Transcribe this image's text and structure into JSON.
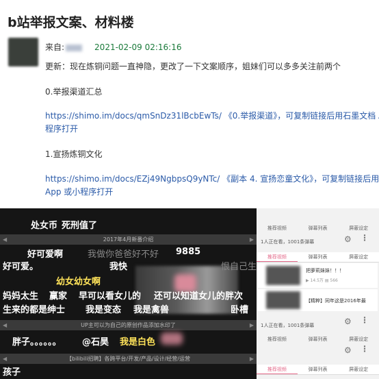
{
  "post": {
    "title": "b站举报文案、材料楼",
    "from_label": "来自:",
    "date": "2021-02-09 02:16:16",
    "update": "更新：现在炼铜问题一直神隐，更改了一下文案顺序，姐妹们可以多多关注前两个",
    "section0_title": "0.举报渠道汇总",
    "section0_url": "https://shimo.im/docs/qmSnDz31lBcbEwTs/",
    "section0_doc": "《0.举报渠道》",
    "section0_suffix": "，可复制链接后用石墨文档 App 或小",
    "section0_suffix2": "程序打开",
    "section1_title": "1.宣扬炼铜文化",
    "section1_url": "https://shimo.im/docs/EZj49NgbpsQ9yNTc/",
    "section1_doc": "《副本 4. 宣扬恋童文化》",
    "section1_suffix": "，可复制链接后用石墨文档",
    "section1_suffix2": "App 或小程序打开"
  },
  "video": {
    "bar1": "2017年4月新番介绍",
    "bar2": "UP主可以为自己的原创作品添加水印了",
    "bar3": "【bilibili招聘】各跨平台/开发/产品/设计/经营/运营",
    "danmaku": [
      "处女币",
      "死刑值了",
      "好可爱啊",
      "我做你爸爸好不好",
      "9885",
      "好可爱。",
      "我快",
      "恨自己生",
      "幼女幼女啊",
      "妈妈太生",
      "赢家",
      "早可以看女儿的",
      "还可以知道女儿的胖次",
      "生来的都是绅士",
      "我是变态",
      "我是禽兽",
      "卧槽",
      "胖子。。。。。。",
      "@石昊",
      "我是白色",
      "孩子"
    ]
  },
  "side": {
    "watching1": "1人正在看，1001条弹幕",
    "watching2": "1人正在看，1001条弹幕",
    "tab_recommend": "推荐视频",
    "tab_danmaku": "弹幕列表",
    "tab_settings": "屏蔽设定",
    "card1_title": "把萝莉妹妹！！！",
    "card1_plays": "14.5万",
    "card1_danmaku": "566",
    "card2_title": "【精粹】同年这是2016年最",
    "card2_meta": "1人正在看，1001条弹幕"
  }
}
